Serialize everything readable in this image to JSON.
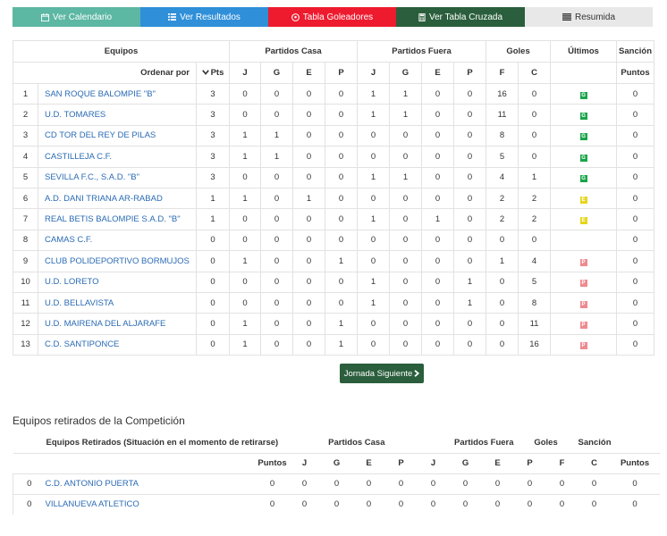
{
  "nav": {
    "calendar": "Ver Calendario",
    "results": "Ver Resultados",
    "scorers": "Tabla Goleadores",
    "cross": "Ver Tabla Cruzada",
    "summary": "Resumida"
  },
  "headers": {
    "equipos": "Equipos",
    "partidos_casa": "Partidos Casa",
    "partidos_fuera": "Partidos Fuera",
    "goles": "Goles",
    "ultimos": "Últimos",
    "sancion": "Sanción",
    "ordenar_por": "Ordenar por",
    "pts": "Pts",
    "j": "J",
    "g": "G",
    "e": "E",
    "p": "P",
    "f": "F",
    "c": "C",
    "puntos": "Puntos"
  },
  "teams": [
    {
      "pos": "1",
      "name": "SAN ROQUE BALOMPIE \"B\"",
      "pts": "3",
      "hj": "0",
      "hg": "0",
      "he": "0",
      "hp": "0",
      "aj": "1",
      "ag": "1",
      "ae": "0",
      "ap": "0",
      "gf": "16",
      "gc": "0",
      "last": "G",
      "pen": "0"
    },
    {
      "pos": "2",
      "name": "U.D. TOMARES",
      "pts": "3",
      "hj": "0",
      "hg": "0",
      "he": "0",
      "hp": "0",
      "aj": "1",
      "ag": "1",
      "ae": "0",
      "ap": "0",
      "gf": "11",
      "gc": "0",
      "last": "G",
      "pen": "0"
    },
    {
      "pos": "3",
      "name": "CD TOR DEL REY DE PILAS",
      "pts": "3",
      "hj": "1",
      "hg": "1",
      "he": "0",
      "hp": "0",
      "aj": "0",
      "ag": "0",
      "ae": "0",
      "ap": "0",
      "gf": "8",
      "gc": "0",
      "last": "G",
      "pen": "0"
    },
    {
      "pos": "4",
      "name": "CASTILLEJA C.F.",
      "pts": "3",
      "hj": "1",
      "hg": "1",
      "he": "0",
      "hp": "0",
      "aj": "0",
      "ag": "0",
      "ae": "0",
      "ap": "0",
      "gf": "5",
      "gc": "0",
      "last": "G",
      "pen": "0"
    },
    {
      "pos": "5",
      "name": "SEVILLA F.C., S.A.D. \"B\"",
      "pts": "3",
      "hj": "0",
      "hg": "0",
      "he": "0",
      "hp": "0",
      "aj": "1",
      "ag": "1",
      "ae": "0",
      "ap": "0",
      "gf": "4",
      "gc": "1",
      "last": "G",
      "pen": "0"
    },
    {
      "pos": "6",
      "name": "A.D. DANI TRIANA AR-RABAD",
      "pts": "1",
      "hj": "1",
      "hg": "0",
      "he": "1",
      "hp": "0",
      "aj": "0",
      "ag": "0",
      "ae": "0",
      "ap": "0",
      "gf": "2",
      "gc": "2",
      "last": "E",
      "pen": "0"
    },
    {
      "pos": "7",
      "name": "REAL BETIS BALOMPIE S.A.D. \"B\"",
      "pts": "1",
      "hj": "0",
      "hg": "0",
      "he": "0",
      "hp": "0",
      "aj": "1",
      "ag": "0",
      "ae": "1",
      "ap": "0",
      "gf": "2",
      "gc": "2",
      "last": "E",
      "pen": "0"
    },
    {
      "pos": "8",
      "name": "CAMAS C.F.",
      "pts": "0",
      "hj": "0",
      "hg": "0",
      "he": "0",
      "hp": "0",
      "aj": "0",
      "ag": "0",
      "ae": "0",
      "ap": "0",
      "gf": "0",
      "gc": "0",
      "last": "",
      "pen": "0"
    },
    {
      "pos": "9",
      "name": "CLUB POLIDEPORTIVO BORMUJOS",
      "pts": "0",
      "hj": "1",
      "hg": "0",
      "he": "0",
      "hp": "1",
      "aj": "0",
      "ag": "0",
      "ae": "0",
      "ap": "0",
      "gf": "1",
      "gc": "4",
      "last": "P",
      "pen": "0"
    },
    {
      "pos": "10",
      "name": "U.D. LORETO",
      "pts": "0",
      "hj": "0",
      "hg": "0",
      "he": "0",
      "hp": "0",
      "aj": "1",
      "ag": "0",
      "ae": "0",
      "ap": "1",
      "gf": "0",
      "gc": "5",
      "last": "P",
      "pen": "0"
    },
    {
      "pos": "11",
      "name": "U.D. BELLAVISTA",
      "pts": "0",
      "hj": "0",
      "hg": "0",
      "he": "0",
      "hp": "0",
      "aj": "1",
      "ag": "0",
      "ae": "0",
      "ap": "1",
      "gf": "0",
      "gc": "8",
      "last": "P",
      "pen": "0"
    },
    {
      "pos": "12",
      "name": "U.D. MAIRENA DEL ALJARAFE",
      "pts": "0",
      "hj": "1",
      "hg": "0",
      "he": "0",
      "hp": "1",
      "aj": "0",
      "ag": "0",
      "ae": "0",
      "ap": "0",
      "gf": "0",
      "gc": "11",
      "last": "P",
      "pen": "0"
    },
    {
      "pos": "13",
      "name": "C.D. SANTIPONCE",
      "pts": "0",
      "hj": "1",
      "hg": "0",
      "he": "0",
      "hp": "1",
      "aj": "0",
      "ag": "0",
      "ae": "0",
      "ap": "0",
      "gf": "0",
      "gc": "16",
      "last": "P",
      "pen": "0"
    }
  ],
  "next_button": "Jornada Siguiente",
  "retired": {
    "title": "Equipos retirados de la Competición",
    "header_equipos": "Equipos Retirados (Situación en el momento de retirarse)",
    "teams": [
      {
        "pos": "0",
        "name": "C.D. ANTONIO PUERTA",
        "pts": "0",
        "hj": "0",
        "hg": "0",
        "he": "0",
        "hp": "0",
        "aj": "0",
        "ag": "0",
        "ae": "0",
        "ap": "0",
        "gf": "0",
        "gc": "0",
        "pen": "0"
      },
      {
        "pos": "0",
        "name": "VILLANUEVA ATLETICO",
        "pts": "0",
        "hj": "0",
        "hg": "0",
        "he": "0",
        "hp": "0",
        "aj": "0",
        "ag": "0",
        "ae": "0",
        "ap": "0",
        "gf": "0",
        "gc": "0",
        "pen": "0"
      }
    ]
  },
  "colors": {
    "calendar": "#5cb7a3",
    "results": "#2f8fd8",
    "scorers": "#ee1b2f",
    "cross": "#2a5e3c",
    "summary": "#e8e8e8",
    "link": "#2a6bb5",
    "win": "#1aa54a",
    "draw": "#e7d51c",
    "loss": "#ef8a8f"
  }
}
